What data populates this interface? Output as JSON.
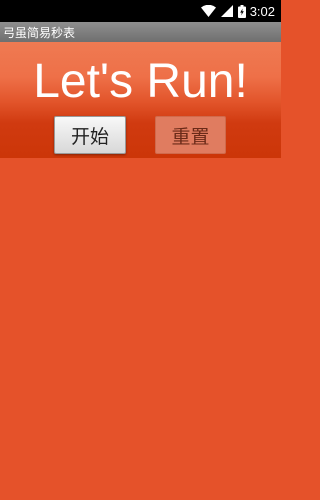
{
  "status_bar": {
    "time": "3:02",
    "icons": [
      "wifi-icon",
      "signal-icon",
      "battery-icon"
    ]
  },
  "app": {
    "title": "弓虽简易秒表"
  },
  "header": {
    "headline": "Let's Run!"
  },
  "buttons": {
    "start_label": "开始",
    "reset_label": "重置"
  },
  "colors": {
    "background": "#e5522a",
    "header_top": "#ef7a52",
    "header_bottom": "#cc3608",
    "reset_button": "#e07c60"
  }
}
